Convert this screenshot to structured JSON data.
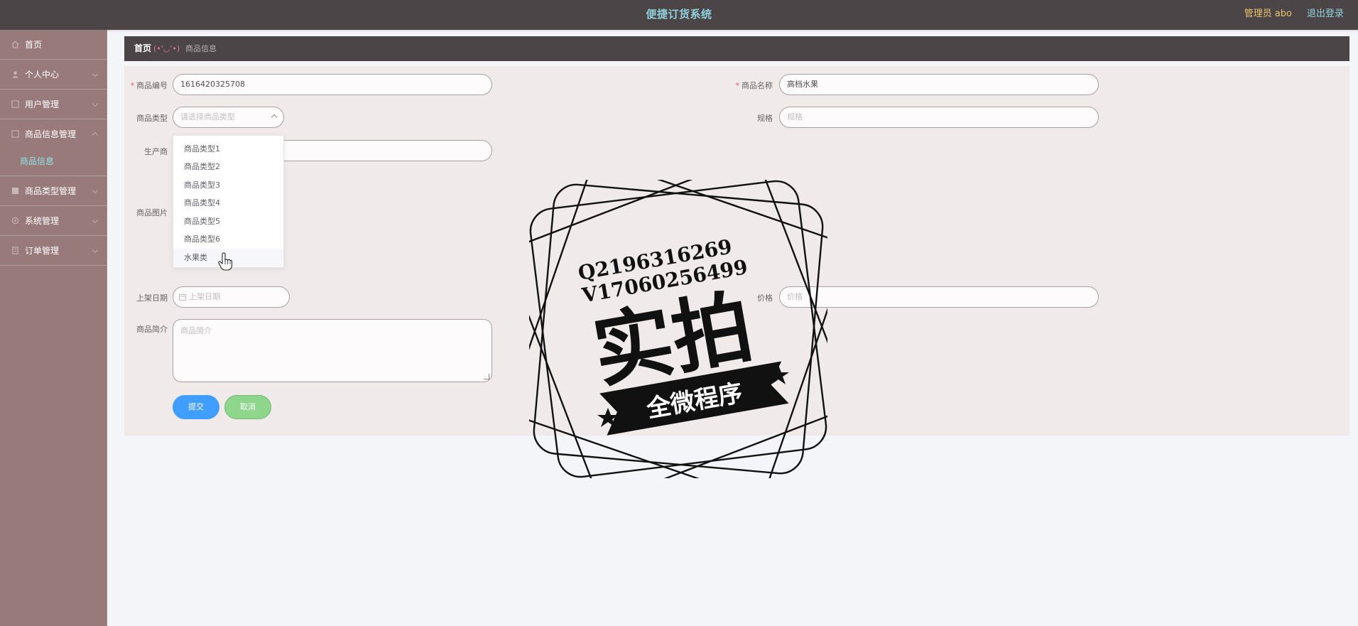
{
  "header": {
    "title": "便捷订货系统",
    "admin": "管理员 abo",
    "logout": "退出登录"
  },
  "sidebar": {
    "items": [
      {
        "label": "首页",
        "icon": "home-icon"
      },
      {
        "label": "个人中心",
        "icon": "user-icon"
      },
      {
        "label": "用户管理",
        "icon": "users-icon"
      },
      {
        "label": "商品信息管理",
        "icon": "goods-icon"
      },
      {
        "label": "商品类型管理",
        "icon": "category-icon"
      },
      {
        "label": "系统管理",
        "icon": "system-icon"
      },
      {
        "label": "订单管理",
        "icon": "order-icon"
      }
    ],
    "sub_items": [
      {
        "label": "商品信息"
      }
    ]
  },
  "breadcrumb": {
    "home": "首页",
    "separator": "(•'◡'•)",
    "current": "商品信息"
  },
  "form": {
    "goods_no": {
      "label": "商品编号",
      "value": "1616420325708"
    },
    "goods_name": {
      "label": "商品名称",
      "value": "高档水果"
    },
    "goods_type": {
      "label": "商品类型",
      "placeholder": "请选择商品类型"
    },
    "spec": {
      "label": "规格",
      "placeholder": "规格"
    },
    "producer": {
      "label": "生产商"
    },
    "image": {
      "label": "商品图片"
    },
    "shelf_date": {
      "label": "上架日期",
      "placeholder": "上架日期"
    },
    "price": {
      "label": "价格",
      "placeholder": "价格"
    },
    "intro": {
      "label": "商品简介",
      "placeholder": "商品简介"
    }
  },
  "dropdown": {
    "options": [
      "商品类型1",
      "商品类型2",
      "商品类型3",
      "商品类型4",
      "商品类型5",
      "商品类型6",
      "水果类"
    ],
    "hovered": "水果类"
  },
  "buttons": {
    "submit": "提交",
    "cancel": "取消"
  },
  "watermark": {
    "line1": "Q2196316269",
    "line2": "V17060256499",
    "big": "实拍",
    "ribbon": "全微程序"
  },
  "colors": {
    "header_bg": "#4c4548",
    "sidebar_bg": "#987a7b",
    "accent_title": "#8fd1d8",
    "admin_text": "#e8c56a",
    "submit_bg": "#409eff",
    "cancel_bg": "#8fd68d",
    "required": "#e85b5b"
  }
}
